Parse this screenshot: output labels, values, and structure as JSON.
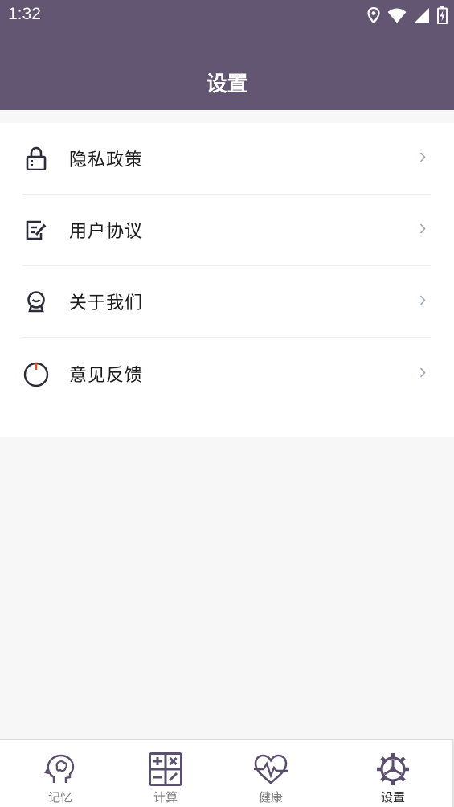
{
  "status_bar": {
    "time": "1:32",
    "icons": [
      "location-icon",
      "wifi-icon",
      "signal-icon",
      "battery-icon"
    ]
  },
  "header": {
    "title": "设置",
    "background": "#625672"
  },
  "menu": {
    "items": [
      {
        "icon": "lock-icon",
        "label": "隐私政策"
      },
      {
        "icon": "edit-document-icon",
        "label": "用户协议"
      },
      {
        "icon": "about-icon",
        "label": "关于我们"
      },
      {
        "icon": "power-icon",
        "label": "意见反馈"
      }
    ],
    "arrow_icon": "chevron-right-icon"
  },
  "tabbar": {
    "tabs": [
      {
        "icon": "brain-head-icon",
        "label": "记忆",
        "active": false
      },
      {
        "icon": "calculator-icon",
        "label": "计算",
        "active": false
      },
      {
        "icon": "heartbeat-icon",
        "label": "健康",
        "active": false
      },
      {
        "icon": "gear-icon",
        "label": "设置",
        "active": true
      }
    ]
  },
  "colors": {
    "accent": "#625672",
    "icon_dark": "#2b2b3a",
    "power_accent": "#e0522a",
    "tab_icon": "#5a4f6c"
  }
}
